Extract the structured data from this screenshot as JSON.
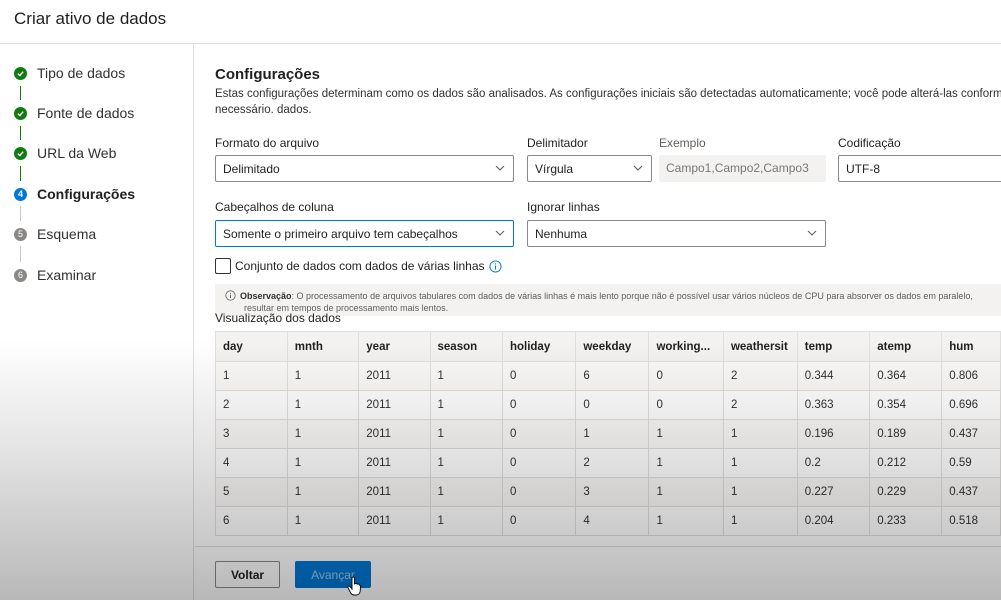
{
  "window": {
    "title": "Criar ativo de dados"
  },
  "steps": [
    {
      "number": "",
      "label": "Tipo de dados",
      "state": "done"
    },
    {
      "number": "",
      "label": "Fonte de dados",
      "state": "done"
    },
    {
      "number": "",
      "label": "URL da Web",
      "state": "done"
    },
    {
      "number": "4",
      "label": "Configurações",
      "state": "current"
    },
    {
      "number": "5",
      "label": "Esquema",
      "state": "pending"
    },
    {
      "number": "6",
      "label": "Examinar",
      "state": "pending"
    }
  ],
  "settings": {
    "title": "Configurações",
    "description": "Estas configurações determinam como os dados são analisados. As configurações iniciais são detectadas automaticamente; você pode alterá-las conforme necessário. dados.",
    "file_format": {
      "label": "Formato do arquivo",
      "value": "Delimitado"
    },
    "delimiter": {
      "label": "Delimitador",
      "value": "Vírgula"
    },
    "example": {
      "label": "Exemplo",
      "value": "Campo1,Campo2,Campo3"
    },
    "encoding": {
      "label": "Codificação",
      "value": "UTF-8"
    },
    "column_headers": {
      "label": "Cabeçalhos de coluna",
      "value": "Somente o primeiro arquivo tem cabeçalhos"
    },
    "skip_rows": {
      "label": "Ignorar linhas",
      "value": "Nenhuma"
    },
    "multiline": {
      "label": "Conjunto de dados com dados de várias linhas",
      "checked": false
    },
    "note": {
      "bold": "Observação",
      "text": ": O processamento de arquivos tabulares com dados de várias linhas é mais lento porque não é possível usar vários núcleos de CPU para absorver os dados em paralelo,",
      "text2": "resultar em tempos de processamento mais lentos."
    }
  },
  "preview": {
    "title": "Visualização dos dados",
    "columns": [
      "day",
      "mnth",
      "year",
      "season",
      "holiday",
      "weekday",
      "working...",
      "weathersit",
      "temp",
      "atemp",
      "hum"
    ],
    "rows": [
      [
        "1",
        "1",
        "2011",
        "1",
        "0",
        "6",
        "0",
        "2",
        "0.344",
        "0.364",
        "0.806"
      ],
      [
        "2",
        "1",
        "2011",
        "1",
        "0",
        "0",
        "0",
        "2",
        "0.363",
        "0.354",
        "0.696"
      ],
      [
        "3",
        "1",
        "2011",
        "1",
        "0",
        "1",
        "1",
        "1",
        "0.196",
        "0.189",
        "0.437"
      ],
      [
        "4",
        "1",
        "2011",
        "1",
        "0",
        "2",
        "1",
        "1",
        "0.2",
        "0.212",
        "0.59"
      ],
      [
        "5",
        "1",
        "2011",
        "1",
        "0",
        "3",
        "1",
        "1",
        "0.227",
        "0.229",
        "0.437"
      ],
      [
        "6",
        "1",
        "2011",
        "1",
        "0",
        "4",
        "1",
        "1",
        "0.204",
        "0.233",
        "0.518"
      ]
    ]
  },
  "footer": {
    "back_label": "Voltar",
    "next_label": "Avançar"
  },
  "colors": {
    "accent": "#0078d4",
    "success": "#107c10",
    "pending": "#8a8886"
  },
  "icons": {
    "done": "checkmark-icon",
    "info": "info-icon",
    "dropdown": "chevron-down-icon"
  }
}
